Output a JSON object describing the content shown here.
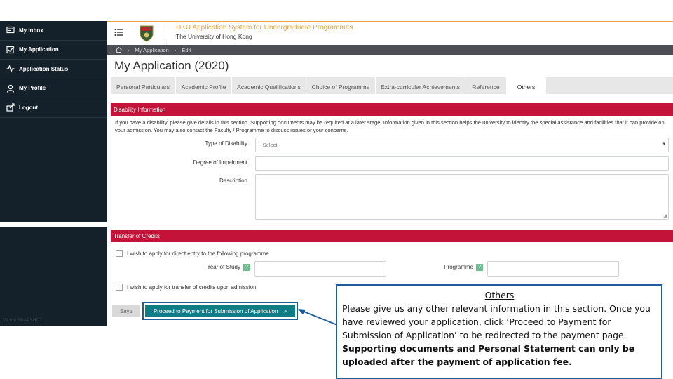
{
  "sidebar": {
    "items": [
      {
        "label": "My Inbox",
        "icon": "inbox-icon"
      },
      {
        "label": "My Application",
        "icon": "checkbox-icon"
      },
      {
        "label": "Application Status",
        "icon": "activity-icon"
      },
      {
        "label": "My Profile",
        "icon": "user-icon"
      },
      {
        "label": "Logout",
        "icon": "logout-icon"
      }
    ],
    "version": "V1.6.8 SNAPSHOT"
  },
  "header": {
    "system_title": "HKU Application System for Undergraduate Programmes",
    "university": "The University of Hong Kong",
    "accent_color": "#e8a33a"
  },
  "breadcrumb": {
    "items": [
      "My Application",
      "Edit"
    ]
  },
  "page_title": "My Application (2020)",
  "tabs": [
    {
      "label": "Personal Particulars",
      "active": false
    },
    {
      "label": "Academic Profile",
      "active": false
    },
    {
      "label": "Academic Qualifications",
      "active": false
    },
    {
      "label": "Choice of Programme",
      "active": false
    },
    {
      "label": "Extra-curricular Achievements",
      "active": false
    },
    {
      "label": "Reference",
      "active": false
    },
    {
      "label": "Others",
      "active": true
    }
  ],
  "disability": {
    "heading": "Disability Information",
    "description": "If you have a disability, please give details in this section. Supporting documents may be required at a later stage. Information given in this section helps the university to identify the special assistance and facilities that it can provide on your admission. You may also contact the Faculty / Programme to discuss issues or your concerns.",
    "type_label": "Type of Disability",
    "type_value": "- Select -",
    "degree_label": "Degree of Impairment",
    "degree_value": "",
    "desc_label": "Description",
    "desc_value": ""
  },
  "transfer": {
    "heading": "Transfer of Credits",
    "direct_entry_label": "I wish to apply for direct entry to the following programme",
    "year_label": "Year of Study",
    "programme_label": "Programme",
    "help_glyph": "?",
    "credit_label": "I wish to apply for transfer of credits upon admission"
  },
  "actions": {
    "save_label": "Save",
    "proceed_label": "Proceed to Payment for Submission of Application",
    "proceed_chevron": ">"
  },
  "callout": {
    "title": "Others",
    "line1": "Please give us any other relevant information in this section. Once you have reviewed your application, click ‘Proceed to Payment for Submission of Application’ to be redirected to the payment page.",
    "line2": "Supporting documents and Personal Statement can only be uploaded after the payment of application fee."
  },
  "colors": {
    "section_header": "#c41338",
    "proceed_button": "#0f7c86",
    "sidebar_bg": "#14212b",
    "callout_border": "#1e5e9b"
  }
}
